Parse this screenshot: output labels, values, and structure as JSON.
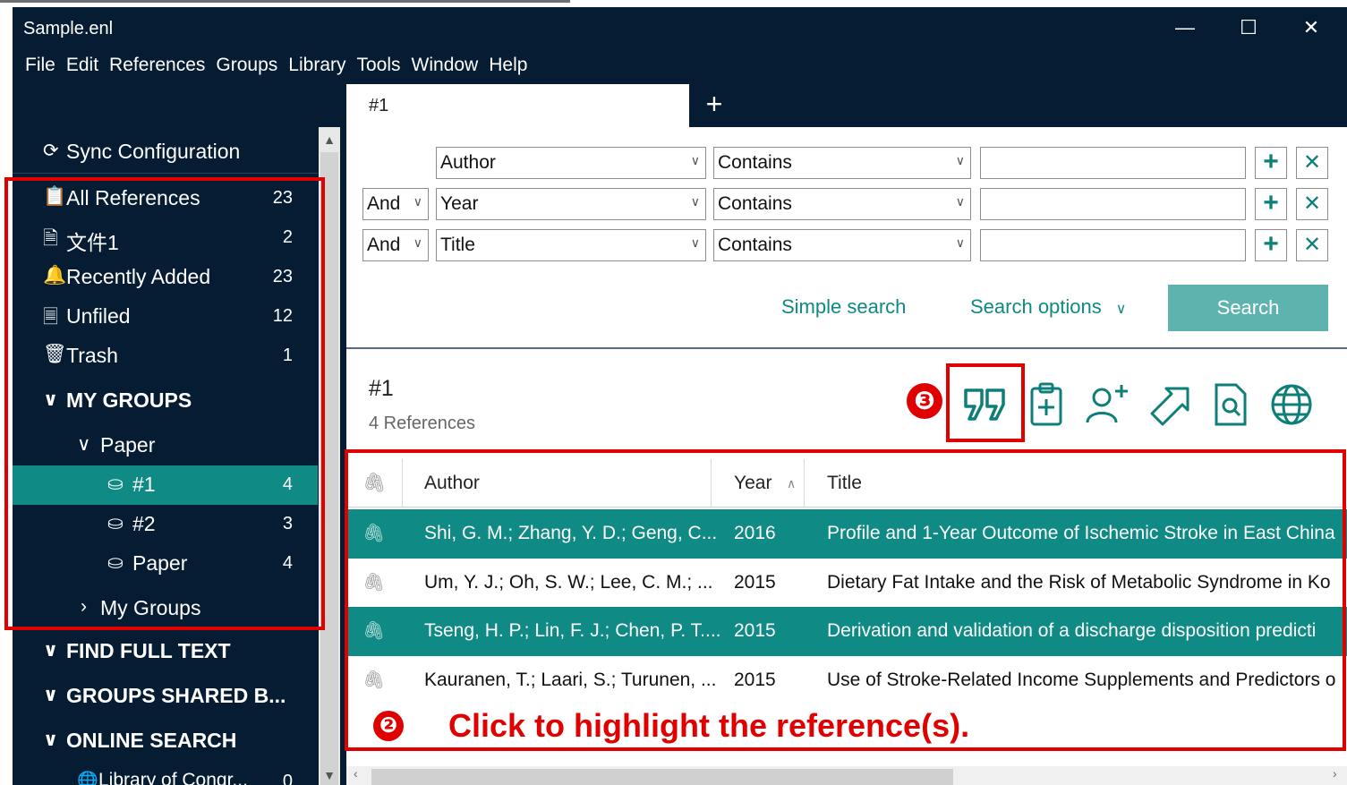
{
  "window": {
    "title": "Sample.enl",
    "controls": {
      "minimize": "—",
      "maximize": "☐",
      "close": "✕"
    }
  },
  "menu": [
    "File",
    "Edit",
    "References",
    "Groups",
    "Library",
    "Tools",
    "Window",
    "Help"
  ],
  "tabs": {
    "active": "#1",
    "add": "+"
  },
  "sidebar": {
    "sync": "Sync Configuration",
    "items": [
      {
        "label": "All References",
        "count": "23",
        "icon": "clipboard-icon"
      },
      {
        "label": "文件1",
        "count": "2",
        "icon": "word-doc-icon"
      },
      {
        "label": "Recently Added",
        "count": "23",
        "icon": "bell-icon"
      },
      {
        "label": "Unfiled",
        "count": "12",
        "icon": "document-icon"
      },
      {
        "label": "Trash",
        "count": "1",
        "icon": "trash-icon"
      }
    ],
    "my_groups_header": "MY GROUPS",
    "group_set": "Paper",
    "groups": [
      {
        "label": "#1",
        "count": "4"
      },
      {
        "label": "#2",
        "count": "3"
      },
      {
        "label": "Paper",
        "count": "4"
      }
    ],
    "my_groups_collapsed": "My Groups",
    "find_full_text": "FIND FULL TEXT",
    "groups_shared": "GROUPS SHARED B...",
    "online_search": "ONLINE SEARCH",
    "online_item": {
      "label": "Library of Congr...",
      "count": "0"
    }
  },
  "search": {
    "rows": [
      {
        "bool": "",
        "field": "Author",
        "op": "Contains",
        "value": ""
      },
      {
        "bool": "And",
        "field": "Year",
        "op": "Contains",
        "value": ""
      },
      {
        "bool": "And",
        "field": "Title",
        "op": "Contains",
        "value": ""
      }
    ],
    "simple": "Simple search",
    "options": "Search options",
    "button": "Search"
  },
  "group_panel": {
    "title": "#1",
    "count": "4 References"
  },
  "toolbar_icons": [
    "quote-icon",
    "clipboard-add-icon",
    "add-user-icon",
    "export-arrow-icon",
    "find-document-icon",
    "globe-icon"
  ],
  "table": {
    "columns": {
      "author": "Author",
      "year": "Year",
      "title": "Title"
    },
    "rows": [
      {
        "author": "Shi, G. M.; Zhang, Y. D.; Geng, C...",
        "year": "2016",
        "title": "Profile and 1-Year Outcome of Ischemic Stroke in East China",
        "highlighted": true
      },
      {
        "author": "Um, Y. J.; Oh, S. W.; Lee, C. M.; ...",
        "year": "2015",
        "title": "Dietary Fat Intake and the Risk of Metabolic Syndrome in Ko",
        "highlighted": false
      },
      {
        "author": "Tseng, H. P.; Lin, F. J.; Chen, P. T....",
        "year": "2015",
        "title": "Derivation and validation of a discharge disposition predicti",
        "highlighted": true
      },
      {
        "author": "Kauranen, T.; Laari, S.; Turunen, ...",
        "year": "2015",
        "title": "Use of Stroke-Related Income Supplements and Predictors o",
        "highlighted": false
      }
    ]
  },
  "annotations": {
    "step2_number": "❷",
    "step2_text": "Click to highlight the reference(s).",
    "step3_number": "❸",
    "color": "#e00000"
  },
  "colors": {
    "teal": "#108a84",
    "navy": "#061c33",
    "search_button": "#5fb3ae"
  }
}
